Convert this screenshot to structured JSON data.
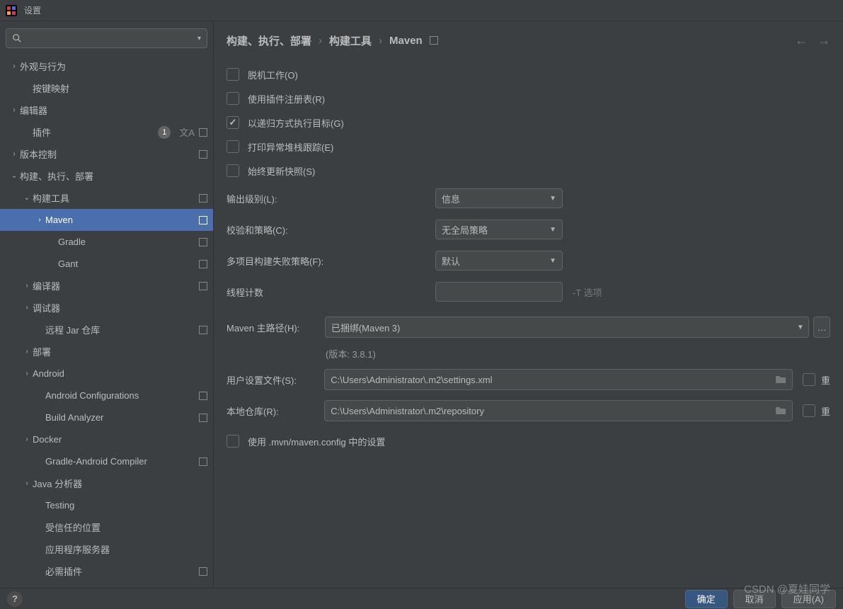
{
  "titlebar": {
    "title": "设置"
  },
  "search": {
    "placeholder": ""
  },
  "sidebar": {
    "items": [
      {
        "label": "外观与行为",
        "arrow": "›",
        "pad": 1
      },
      {
        "label": "按键映射",
        "arrow": "",
        "pad": 2
      },
      {
        "label": "编辑器",
        "arrow": "›",
        "pad": 1
      },
      {
        "label": "插件",
        "arrow": "",
        "pad": 2,
        "badge": "1",
        "lang": true,
        "ind": true
      },
      {
        "label": "版本控制",
        "arrow": "›",
        "pad": 1,
        "ind": true
      },
      {
        "label": "构建、执行、部署",
        "arrow": "⌄",
        "pad": 1
      },
      {
        "label": "构建工具",
        "arrow": "⌄",
        "pad": 2,
        "ind": true
      },
      {
        "label": "Maven",
        "arrow": "›",
        "pad": 3,
        "ind": true,
        "selected": true
      },
      {
        "label": "Gradle",
        "arrow": "",
        "pad": 4,
        "ind": true
      },
      {
        "label": "Gant",
        "arrow": "",
        "pad": 4,
        "ind": true
      },
      {
        "label": "编译器",
        "arrow": "›",
        "pad": 2,
        "ind": true
      },
      {
        "label": "调试器",
        "arrow": "›",
        "pad": 2
      },
      {
        "label": "远程 Jar 仓库",
        "arrow": "",
        "pad": 3,
        "ind": true
      },
      {
        "label": "部署",
        "arrow": "›",
        "pad": 2
      },
      {
        "label": "Android",
        "arrow": "›",
        "pad": 2
      },
      {
        "label": "Android Configurations",
        "arrow": "",
        "pad": 3,
        "ind": true
      },
      {
        "label": "Build Analyzer",
        "arrow": "",
        "pad": 3,
        "ind": true
      },
      {
        "label": "Docker",
        "arrow": "›",
        "pad": 2
      },
      {
        "label": "Gradle-Android Compiler",
        "arrow": "",
        "pad": 3,
        "ind": true
      },
      {
        "label": "Java 分析器",
        "arrow": "›",
        "pad": 2
      },
      {
        "label": "Testing",
        "arrow": "",
        "pad": 3
      },
      {
        "label": "受信任的位置",
        "arrow": "",
        "pad": 3
      },
      {
        "label": "应用程序服务器",
        "arrow": "",
        "pad": 3
      },
      {
        "label": "必需插件",
        "arrow": "",
        "pad": 3,
        "ind": true
      }
    ]
  },
  "breadcrumb": {
    "a": "构建、执行、部署",
    "b": "构建工具",
    "c": "Maven",
    "sep": "›"
  },
  "checks": {
    "offline": "脱机工作(O)",
    "plugin_registry": "使用插件注册表(R)",
    "recursive": "以递归方式执行目标(G)",
    "print_stack": "打印异常堆栈跟踪(E)",
    "update_snapshot": "始终更新快照(S)",
    "use_config": "使用 .mvn/maven.config 中的设置"
  },
  "labels": {
    "output_level": "输出级别(L):",
    "checksum_policy": "校验和策略(C):",
    "multi_fail": "多项目构建失败策略(F):",
    "thread_count": "线程计数",
    "thread_hint": "-T 选项",
    "maven_home": "Maven 主路径(H):",
    "version_note": "(版本: 3.8.1)",
    "user_settings": "用户设置文件(S):",
    "local_repo": "本地仓库(R):",
    "override": "重"
  },
  "values": {
    "output_level": "信息",
    "checksum_policy": "无全局策略",
    "multi_fail": "默认",
    "thread_count": "",
    "maven_home": "已捆绑(Maven 3)",
    "user_settings": "C:\\Users\\Administrator\\.m2\\settings.xml",
    "local_repo": "C:\\Users\\Administrator\\.m2\\repository"
  },
  "buttons": {
    "ok": "确定",
    "cancel": "取消",
    "apply": "应用(A)"
  },
  "watermark": "CSDN @夏娃同学"
}
